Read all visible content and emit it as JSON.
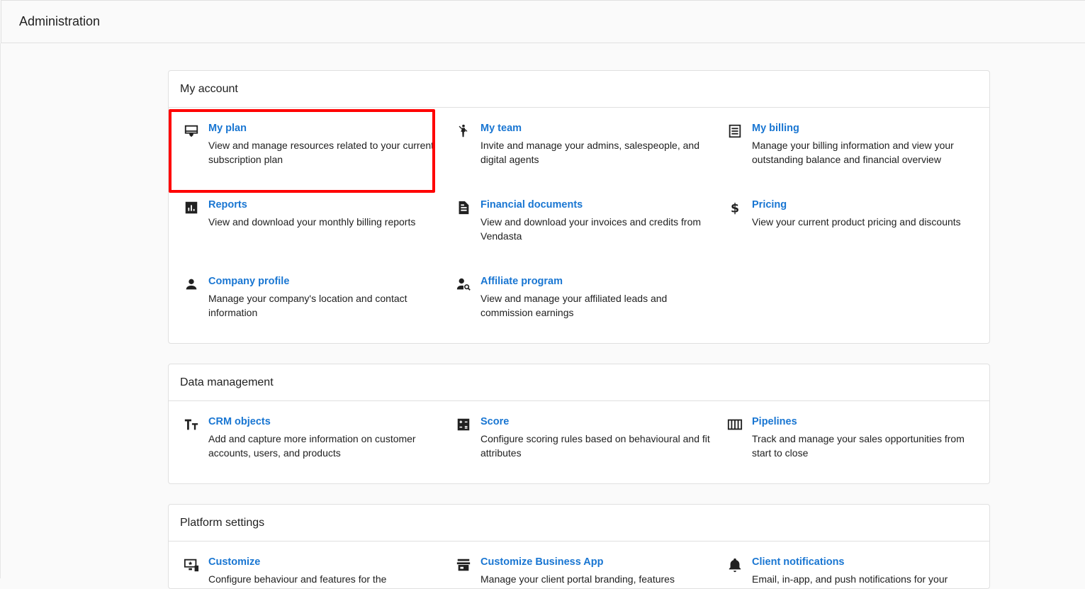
{
  "header": {
    "title": "Administration"
  },
  "sections": [
    {
      "title": "My account",
      "items": [
        {
          "icon": "plan-icon",
          "title": "My plan",
          "description": "View and manage resources related to your current subscription plan"
        },
        {
          "icon": "team-icon",
          "title": "My team",
          "description": "Invite and manage your admins, salespeople, and digital agents"
        },
        {
          "icon": "billing-icon",
          "title": "My billing",
          "description": "Manage your billing information and view your outstanding balance and financial overview"
        },
        {
          "icon": "reports-icon",
          "title": "Reports",
          "description": "View and download your monthly billing reports"
        },
        {
          "icon": "document-icon",
          "title": "Financial documents",
          "description": "View and download your invoices and credits from Vendasta"
        },
        {
          "icon": "dollar-icon",
          "title": "Pricing",
          "description": "View your current product pricing and discounts"
        },
        {
          "icon": "person-icon",
          "title": "Company profile",
          "description": "Manage your company's location and contact information"
        },
        {
          "icon": "person-search-icon",
          "title": "Affiliate program",
          "description": "View and manage your affiliated leads and commission earnings"
        }
      ]
    },
    {
      "title": "Data management",
      "items": [
        {
          "icon": "text-fields-icon",
          "title": "CRM objects",
          "description": "Add and capture more information on customer accounts, users, and products"
        },
        {
          "icon": "calculate-icon",
          "title": "Score",
          "description": "Configure scoring rules based on behavioural and fit attributes"
        },
        {
          "icon": "columns-icon",
          "title": "Pipelines",
          "description": "Track and manage your sales opportunities from start to close"
        }
      ]
    },
    {
      "title": "Platform settings",
      "items": [
        {
          "icon": "customize-icon",
          "title": "Customize",
          "description": "Configure behaviour and features for the"
        },
        {
          "icon": "storefront-icon",
          "title": "Customize Business App",
          "description": "Manage your client portal branding, features"
        },
        {
          "icon": "bell-icon",
          "title": "Client notifications",
          "description": "Email, in-app, and push notifications for your"
        }
      ]
    }
  ]
}
